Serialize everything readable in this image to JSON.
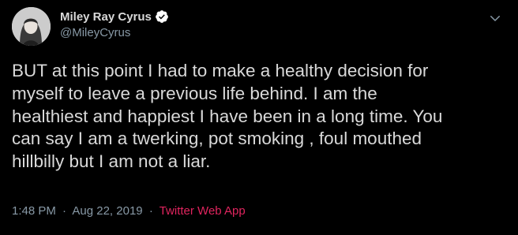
{
  "tweet": {
    "author": {
      "name": "Miley Ray Cyrus",
      "handle": "@MileyCyrus",
      "verified": true
    },
    "text": "BUT at this point I had to make a healthy decision for\nmyself to leave a previous life behind. I am the\nhealthiest and happiest I have been in a long time.  You\ncan say I am a twerking, pot smoking , foul mouthed\nhillbilly but I am not a liar.",
    "time": "1:48 PM",
    "separator": "·",
    "date": "Aug 22, 2019",
    "source": "Twitter Web App"
  },
  "colors": {
    "background": "#000000",
    "text": "#d9d9d9",
    "secondary_text": "#8899a6",
    "source_link": "#e0245e",
    "verified_badge": "#ffffff"
  },
  "icons": {
    "verified": "verified-badge-icon",
    "menu": "chevron-down-icon"
  }
}
